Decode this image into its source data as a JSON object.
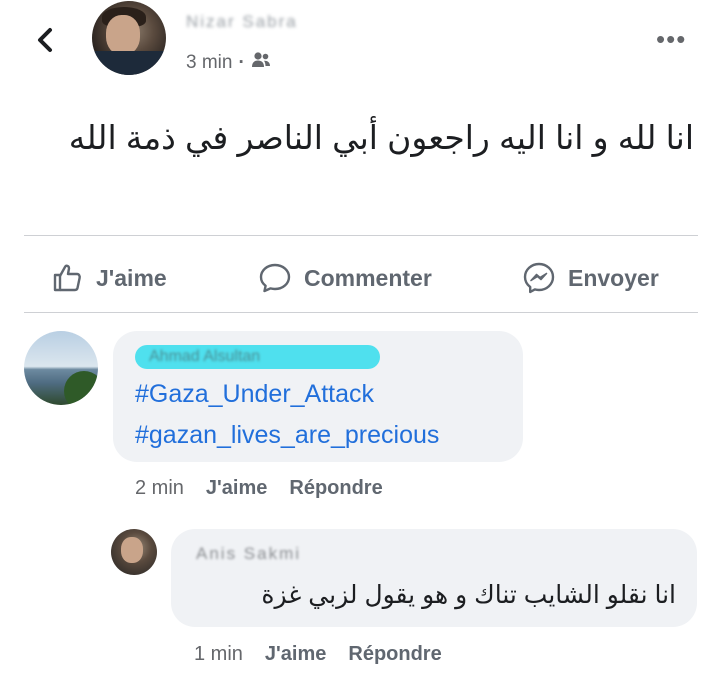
{
  "post": {
    "author_name": "Nizar Sabra",
    "time": "3 min",
    "time_separator": "·",
    "audience_icon": "friends-icon",
    "text": "انا لله و انا اليه راجعون أبي الناصر في ذمة الله",
    "actions": {
      "like": "J'aime",
      "comment": "Commenter",
      "send": "Envoyer"
    }
  },
  "comments": [
    {
      "author_name": "Ahmad Alsultan",
      "tags": [
        "#Gaza_Under_Attack",
        "#gazan_lives_are_precious"
      ],
      "time": "2 min",
      "like": "J'aime",
      "reply": "Répondre",
      "name_highlight_color": "#4fe0ee"
    },
    {
      "author_name": "Anis Sakmi",
      "text": "انا نقلو الشايب تناك و هو يقول لزبي غزة",
      "time": "1 min",
      "like": "J'aime",
      "reply": "Répondre"
    }
  ],
  "colors": {
    "link": "#216fdb",
    "muted": "#65676b",
    "bubble": "#f0f2f5"
  }
}
